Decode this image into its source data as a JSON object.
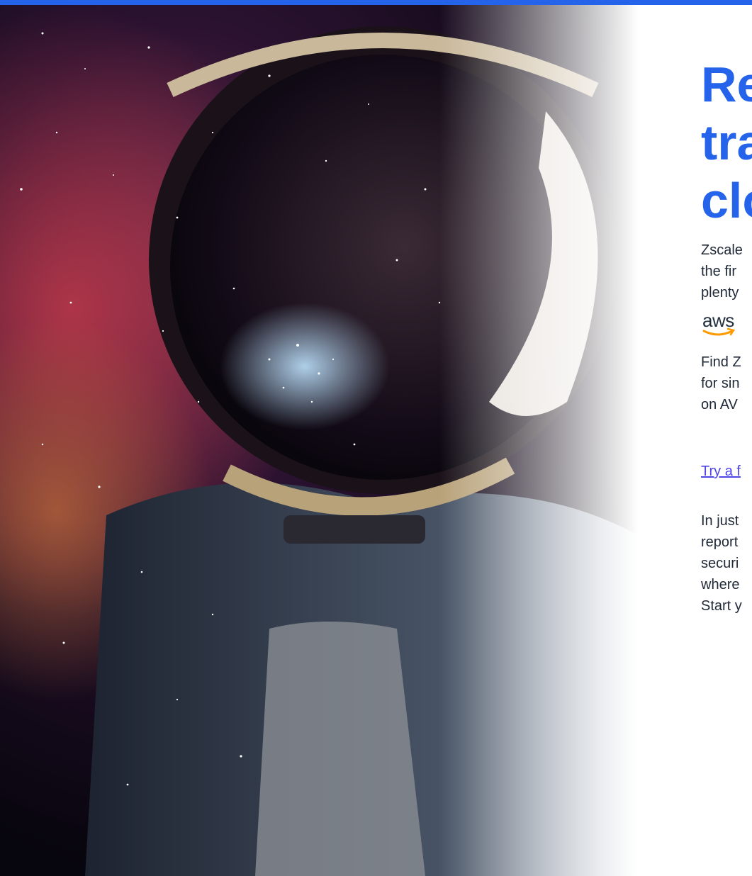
{
  "colors": {
    "accent": "#2563eb",
    "link": "#4f46e5",
    "aws_orange": "#ff9900"
  },
  "hero": {
    "image": "astronaut-galaxy-helmet-image"
  },
  "headline_lines": [
    "Re",
    "tra",
    "clo"
  ],
  "intro_lines": [
    "Zscale",
    "the fir",
    "plenty"
  ],
  "aws_logo": {
    "text": "aws"
  },
  "aws_lines": [
    "Find Z",
    "for sin",
    "on AV"
  ],
  "trial_link": "Try a f",
  "trial_lines": [
    "In just",
    "report",
    "securi",
    "where",
    "Start y"
  ]
}
